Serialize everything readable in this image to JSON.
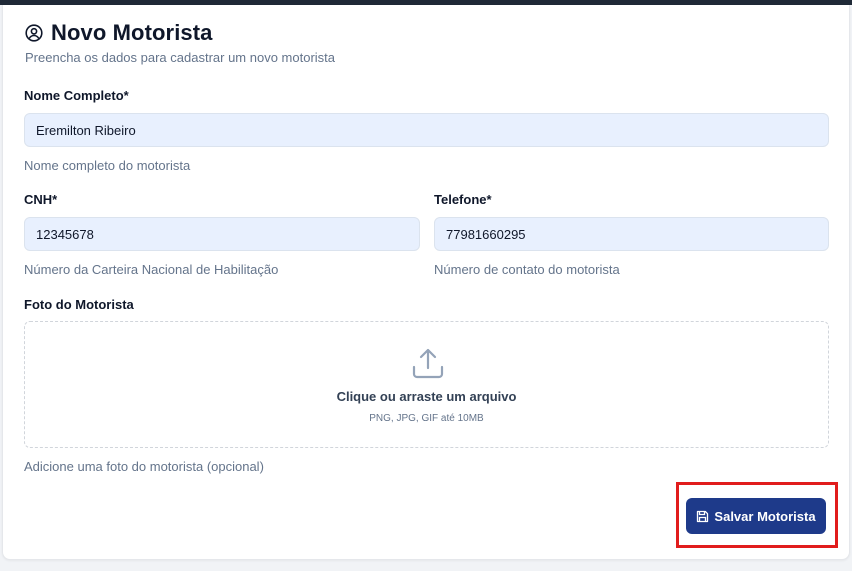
{
  "header": {
    "title": "Novo Motorista",
    "subtitle": "Preencha os dados para cadastrar um novo motorista",
    "icon": "user-circle-icon"
  },
  "form": {
    "nome": {
      "label": "Nome Completo*",
      "value": "Eremilton Ribeiro",
      "hint": "Nome completo do motorista"
    },
    "cnh": {
      "label": "CNH*",
      "value": "12345678",
      "hint": "Número da Carteira Nacional de Habilitação"
    },
    "telefone": {
      "label": "Telefone*",
      "value": "77981660295",
      "hint": "Número de contato do motorista"
    },
    "foto": {
      "label": "Foto do Motorista",
      "dropzone_title": "Clique ou arraste um arquivo",
      "dropzone_subtitle": "PNG, JPG, GIF até 10MB",
      "hint": "Adicione uma foto do motorista (opcional)",
      "icon": "upload-icon"
    }
  },
  "actions": {
    "save_label": "Salvar Motorista",
    "save_icon": "save-icon"
  },
  "colors": {
    "primary": "#1e3a8a",
    "input_bg": "#e8f0fe",
    "highlight": "#e11d1d"
  }
}
